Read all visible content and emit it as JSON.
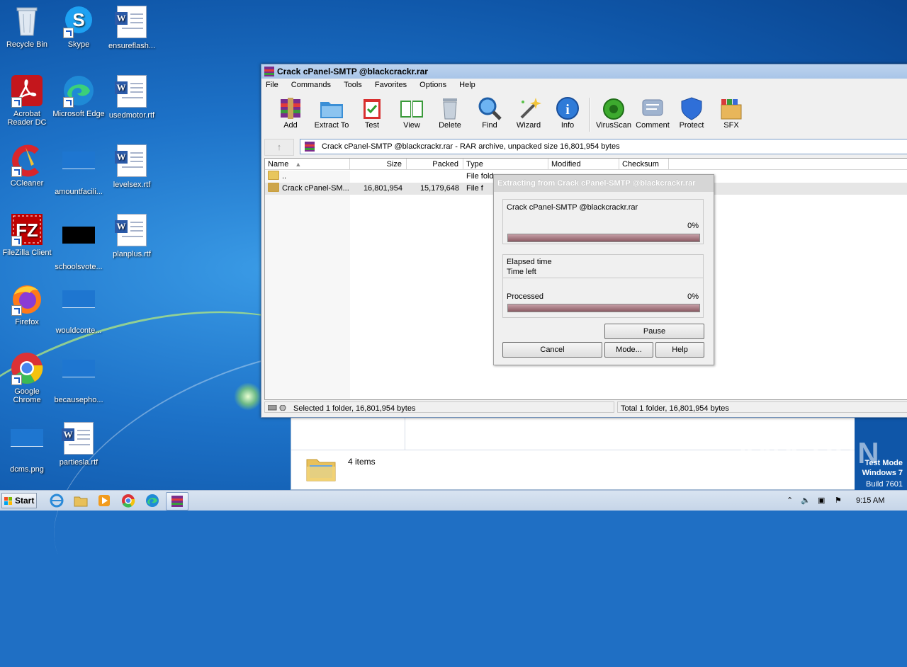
{
  "desktop": {
    "icons": [
      {
        "label": "Recycle Bin",
        "icon": "recycle-bin-icon"
      },
      {
        "label": "Skype",
        "icon": "skype-icon"
      },
      {
        "label": "ensureflash...",
        "icon": "word-doc-icon"
      },
      {
        "label": "Acrobat Reader DC",
        "icon": "acrobat-icon"
      },
      {
        "label": "Microsoft Edge",
        "icon": "edge-icon"
      },
      {
        "label": "usedmotor.rtf",
        "icon": "word-doc-icon"
      },
      {
        "label": "CCleaner",
        "icon": "ccleaner-icon"
      },
      {
        "label": "amountfacili...",
        "icon": "blank-file-icon"
      },
      {
        "label": "levelsex.rtf",
        "icon": "word-doc-icon"
      },
      {
        "label": "FileZilla Client",
        "icon": "filezilla-icon"
      },
      {
        "label": "schoolsvote...",
        "icon": "black-image-icon"
      },
      {
        "label": "planplus.rtf",
        "icon": "word-doc-icon"
      },
      {
        "label": "Firefox",
        "icon": "firefox-icon"
      },
      {
        "label": "wouldconte...",
        "icon": "blank-file-icon"
      },
      {
        "label": "Google Chrome",
        "icon": "chrome-icon"
      },
      {
        "label": "becausepho...",
        "icon": "blank-file-icon"
      },
      {
        "label": "dcms.png",
        "icon": "blank-file-icon"
      },
      {
        "label": "partiesla.rtf",
        "icon": "word-doc-icon"
      }
    ]
  },
  "winrar": {
    "title": "Crack cPanel-SMTP @blackcrackr.rar",
    "menu": [
      "File",
      "Commands",
      "Tools",
      "Favorites",
      "Options",
      "Help"
    ],
    "toolbar": [
      "Add",
      "Extract To",
      "Test",
      "View",
      "Delete",
      "Find",
      "Wizard",
      "Info",
      "VirusScan",
      "Comment",
      "Protect",
      "SFX"
    ],
    "address": "Crack cPanel-SMTP @blackcrackr.rar - RAR archive, unpacked size 16,801,954 bytes",
    "columns": [
      "Name",
      "Size",
      "Packed",
      "Type",
      "Modified",
      "Checksum"
    ],
    "rows": [
      {
        "name": "..",
        "size": "",
        "packed": "",
        "type": "File fold"
      },
      {
        "name": "Crack cPanel-SM...",
        "size": "16,801,954",
        "packed": "15,179,648",
        "type": "File f"
      }
    ],
    "status_left": "Selected 1 folder, 16,801,954 bytes",
    "status_right": "Total 1 folder, 16,801,954 bytes"
  },
  "dialog": {
    "title": "Extracting from Crack cPanel-SMTP @blackcrackr.rar",
    "filename": "Crack cPanel-SMTP @blackcrackr.rar",
    "file_percent": "0%",
    "elapsed_label": "Elapsed time",
    "timeleft_label": "Time left",
    "processed_label": "Processed",
    "processed_percent": "0%",
    "pause": "Pause",
    "cancel": "Cancel",
    "mode": "Mode...",
    "help": "Help"
  },
  "explorer": {
    "items": "4 items"
  },
  "watermark": "ANY RUN",
  "test_mode": {
    "line1": "Test Mode",
    "line2": "Windows 7",
    "line3": "Build 7601"
  },
  "taskbar": {
    "start": "Start",
    "clock": "9:15 AM"
  }
}
